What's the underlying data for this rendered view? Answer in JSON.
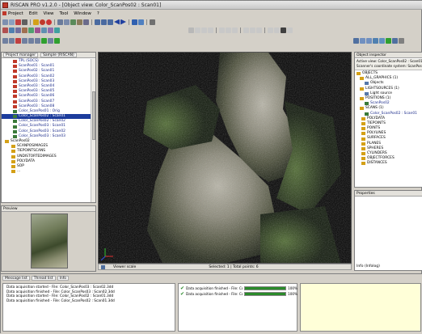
{
  "window": {
    "title": "RISCAN PRO v1.2.0 - [Object view: Color_ScanPos02 : Scan01]"
  },
  "menu": {
    "items": [
      "Project",
      "Edit",
      "View",
      "Tool",
      "Window",
      "?"
    ]
  },
  "left_panel": {
    "tabs": [
      "Project manager",
      "Sample (RISCAN)"
    ],
    "tree": [
      {
        "label": "TPL (SOCS)",
        "color": "#c0392b"
      },
      {
        "label": "ScanPos01 : Scan01",
        "color": "#c0392b"
      },
      {
        "label": "ScanPos02 : Scan01",
        "color": "#c0392b"
      },
      {
        "label": "ScanPos03 : Scan02",
        "color": "#c0392b"
      },
      {
        "label": "ScanPos03 : Scan03",
        "color": "#c0392b"
      },
      {
        "label": "ScanPos03 : Scan04",
        "color": "#c0392b"
      },
      {
        "label": "ScanPos03 : Scan05",
        "color": "#c0392b"
      },
      {
        "label": "ScanPos03 : Scan06",
        "color": "#c0392b"
      },
      {
        "label": "ScanPos03 : Scan07",
        "color": "#c0392b"
      },
      {
        "label": "ScanPos03 : Scan08",
        "color": "#c0392b"
      },
      {
        "label": "Color_ScanPos01 : Orig",
        "color": "#3a7a3a"
      },
      {
        "label": "Color_ScanPos02 : Scan01",
        "color": "#3a7a3a",
        "selected": true
      },
      {
        "label": "Color_ScanPos02 : Scan02",
        "color": "#3a7a3a"
      },
      {
        "label": "Color_ScanPos03 : Scan01",
        "color": "#3a7a3a"
      },
      {
        "label": "Color_ScanPos03 : Scan02",
        "color": "#3a7a3a"
      },
      {
        "label": "Color_ScanPos03 : Scan03",
        "color": "#3a7a3a"
      },
      {
        "label": "ScanPos02",
        "color": "#d4a017",
        "indent": 0
      },
      {
        "label": "SCANPOSIMAGES",
        "color": "#d4a017"
      },
      {
        "label": "TIEPOINTSCANS",
        "color": "#d4a017"
      },
      {
        "label": "UNDISTORTEDIMAGES",
        "color": "#d4a017"
      },
      {
        "label": "POLYDATA",
        "color": "#d4a017"
      },
      {
        "label": "SOP",
        "color": "#d4a017"
      },
      {
        "label": "...",
        "color": "#d4a017"
      }
    ],
    "preview_title": "Preview"
  },
  "viewport": {
    "status_left": "Viewer scale",
    "status_right": "Selected: 1 | Total points: 6"
  },
  "right_panel": {
    "title": "Object inspector",
    "header1": "Active view: Color_ScanPos02 : Scan01",
    "header2": "Scanner's coordinate system: ScanPos02",
    "tree": [
      {
        "label": "OBJECTS",
        "color": "#d4a017"
      },
      {
        "label": "ALL_GRAPHICS (1)",
        "color": "#d4a017"
      },
      {
        "label": "Objects",
        "color": "#5577aa"
      },
      {
        "label": "LIGHTSOURCES (1)",
        "color": "#d4a017"
      },
      {
        "label": "Light source",
        "color": "#5577aa"
      },
      {
        "label": "POSITIONS (1)",
        "color": "#d4a017"
      },
      {
        "label": "ScanPos02",
        "color": "#3a7a3a"
      },
      {
        "label": "SCANS (1)",
        "color": "#d4a017"
      },
      {
        "label": "Color_ScanPos02 : Scan01",
        "color": "#3a7a3a"
      },
      {
        "label": "POLYDATA",
        "color": "#d4a017"
      },
      {
        "label": "TIEPOINTS",
        "color": "#d4a017"
      },
      {
        "label": "POINTS",
        "color": "#d4a017"
      },
      {
        "label": "POLYLINES",
        "color": "#d4a017"
      },
      {
        "label": "SURFACES",
        "color": "#d4a017"
      },
      {
        "label": "PLANES",
        "color": "#d4a017"
      },
      {
        "label": "SPHERES",
        "color": "#d4a017"
      },
      {
        "label": "CYLINDERS",
        "color": "#d4a017"
      },
      {
        "label": "OBJECTFORCES",
        "color": "#d4a017"
      },
      {
        "label": "DISTANCES",
        "color": "#d4a017"
      }
    ],
    "properties_title": "Properties",
    "info_label": "Info (Infolog)"
  },
  "messages": {
    "tabs": [
      "Message list",
      "Thread list",
      "Info"
    ],
    "lines": [
      "Data acquisition started - File: Color_ScanPos03 : Scan02.3dd",
      "Data acquisition finished - File: Color_ScanPos03 : Scan02.3dd",
      "Data acquisition started - File: Color_ScanPos02 : Scan01.3dd",
      "Data acquisition finished - File: Color_ScanPos02 : Scan01.3dd"
    ],
    "threads": [
      {
        "label": "Data acquisition finished - File: Color_...",
        "pct": "100%",
        "value": 1.0
      },
      {
        "label": "Data acquisition finished - File: Color_...",
        "pct": "100%",
        "value": 1.0
      }
    ]
  }
}
